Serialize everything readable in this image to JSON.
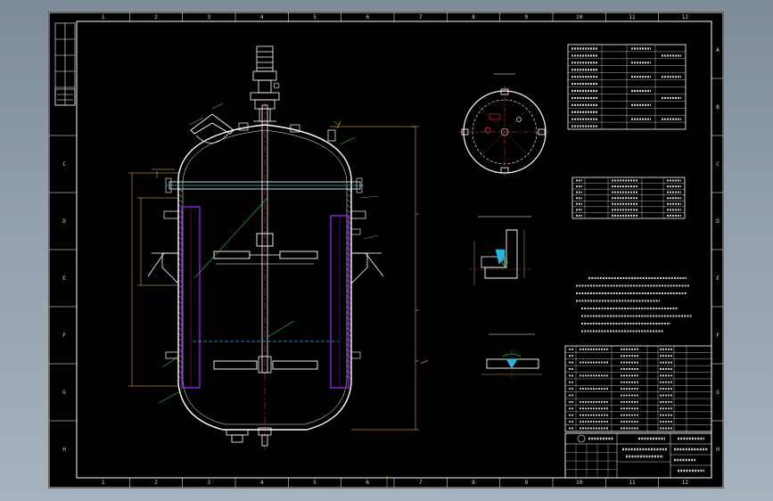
{
  "frame": {
    "top_numbers": [
      "1",
      "2",
      "3",
      "4",
      "5",
      "6",
      "7",
      "8",
      "9",
      "10",
      "11",
      "12"
    ],
    "side_letters": [
      "A",
      "B",
      "C",
      "D",
      "E",
      "F",
      "G",
      "H"
    ]
  },
  "views": {
    "top_view_title": "",
    "detail1_title": "",
    "detail2_title": ""
  },
  "tables": {
    "spec_title": "",
    "nozzle_title": "",
    "notes_title": ""
  },
  "colors": {
    "background": "#000000",
    "outline": "#ffffff",
    "baffle": "#a020f0",
    "centerline": "#ff3030",
    "dimension": "#ffcc55",
    "leader": "#33cc33",
    "heat": "#22bbdd"
  }
}
